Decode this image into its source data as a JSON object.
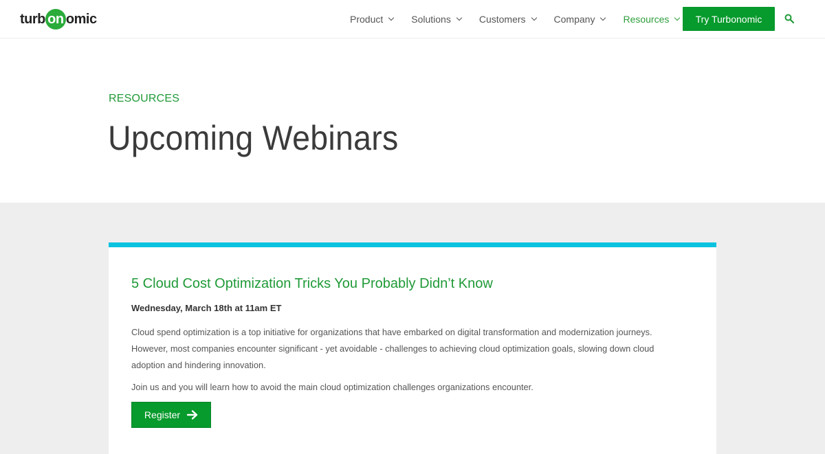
{
  "header": {
    "logo": {
      "pre": "turb",
      "mid": "on",
      "post": "omic"
    },
    "nav": [
      {
        "label": "Product",
        "active": false
      },
      {
        "label": "Solutions",
        "active": false
      },
      {
        "label": "Customers",
        "active": false
      },
      {
        "label": "Company",
        "active": false
      },
      {
        "label": "Resources",
        "active": true
      }
    ],
    "cta_label": "Try Turbonomic",
    "search_icon": "search-icon"
  },
  "hero": {
    "eyebrow": "RESOURCES",
    "title": "Upcoming Webinars"
  },
  "webinars": [
    {
      "title": "5 Cloud Cost Optimization Tricks You Probably Didn’t Know",
      "date": "Wednesday, March 18th at 11am ET",
      "description": "Cloud spend optimization is a top initiative for organizations that have embarked on digital transformation and modernization journeys. However, most companies encounter significant - yet avoidable - challenges to achieving cloud optimization goals, slowing down cloud adoption and hindering innovation.",
      "join_text": "Join us and you will learn how to avoid the main cloud optimization challenges organizations encounter.",
      "register_label": "Register"
    }
  ],
  "colors": {
    "brand_green": "#079a2c",
    "accent_green_text": "#1f9a37",
    "card_top_bar": "#0bc2df",
    "band_bg": "#eeeeee"
  }
}
